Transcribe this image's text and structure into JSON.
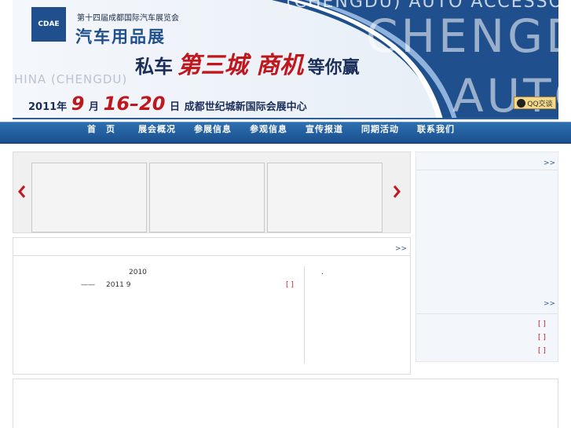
{
  "banner": {
    "ghost_top": "(CHENGDU) AUTO ACCESSORIE",
    "ghost_big": "CHENGDU",
    "ghost_left": "HINA (CHENGDU)",
    "ghost_auto": "AUTO",
    "logo_text": "CDAE",
    "expo_subtitle": "第十四届成都国际汽车展览会",
    "expo_title": "汽车用品展",
    "slogan_a": "私车",
    "slogan_b": "第三城 商机",
    "slogan_c": "等你赢",
    "date_year": "2011年",
    "date_month_num": "9",
    "date_month_unit": "月",
    "date_days": "16–20",
    "date_day_unit": "日",
    "venue": "成都世纪城新国际会展中心",
    "qq_button": "QQ交谈"
  },
  "nav": {
    "items": [
      "首　页",
      "展会概况",
      "参展信息",
      "参观信息",
      "宣传报道",
      "同期活动",
      "联系我们"
    ]
  },
  "news": {
    "more": ">>",
    "line1": "2010",
    "line2_dash": "——",
    "line2": "2011 9",
    "bracket": "[ ]",
    "dot": "."
  },
  "side": {
    "more_top": ">>",
    "more_bottom": ">>",
    "brackets": [
      "[ ]",
      "[ ]",
      "[ ]"
    ]
  },
  "colors": {
    "nav_blue": "#1a4f8e",
    "accent_red": "#c0171d",
    "link_blue": "#2d5c99"
  },
  "icons": {
    "prev": "chevron-left-icon",
    "next": "chevron-right-icon",
    "qq": "qq-penguin-icon"
  }
}
